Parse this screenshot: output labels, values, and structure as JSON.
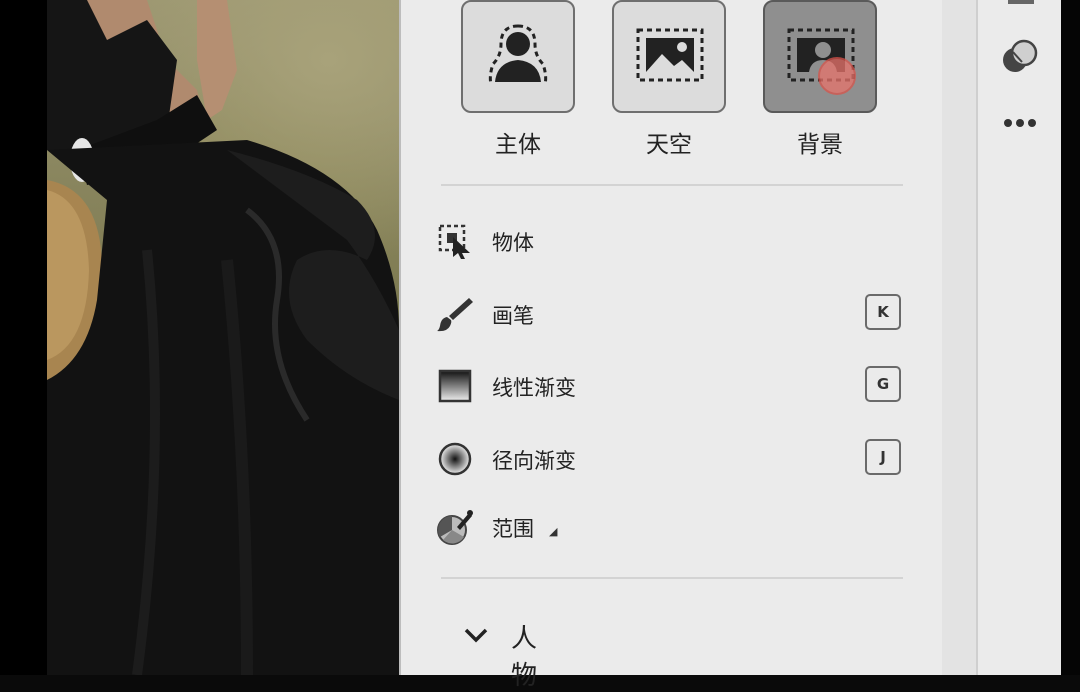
{
  "mask_types": [
    {
      "label": "主体",
      "icon": "subject-icon",
      "active": false
    },
    {
      "label": "天空",
      "icon": "sky-icon",
      "active": false
    },
    {
      "label": "背景",
      "icon": "background-icon",
      "active": true
    }
  ],
  "tools": [
    {
      "label": "物体",
      "icon": "object-select-icon",
      "shortcut": ""
    },
    {
      "label": "画笔",
      "icon": "brush-icon",
      "shortcut": "K"
    },
    {
      "label": "线性渐变",
      "icon": "linear-gradient-icon",
      "shortcut": "G"
    },
    {
      "label": "径向渐变",
      "icon": "radial-gradient-icon",
      "shortcut": "J"
    },
    {
      "label": "范围",
      "icon": "range-picker-icon",
      "shortcut": ""
    }
  ],
  "people_section": {
    "label": "人物"
  },
  "toolbar": {
    "icons": [
      "mask-icon",
      "more-options-icon"
    ]
  },
  "colors": {
    "panel_bg": "#ebebeb",
    "active_tile": "#8f8f8f",
    "cursor_highlight": "#e8736b"
  }
}
